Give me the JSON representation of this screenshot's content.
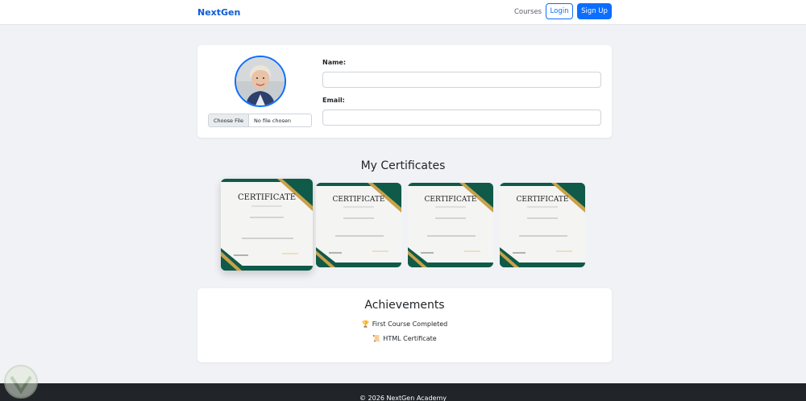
{
  "navbar": {
    "brand": "NextGen",
    "links": [
      {
        "label": "Courses"
      }
    ],
    "login_label": "Login",
    "signup_label": "Sign Up"
  },
  "profile": {
    "file_button_label": "Choose File",
    "file_status": "No file chosen",
    "name_label": "Name:",
    "name_value": "",
    "email_label": "Email:",
    "email_value": ""
  },
  "certificates": {
    "title": "My Certificates",
    "items": [
      {
        "heading": "CERTIFICATE"
      },
      {
        "heading": "CERTIFICATE"
      },
      {
        "heading": "CERTIFICATE"
      },
      {
        "heading": "CERTIFICATE"
      }
    ]
  },
  "achievements": {
    "title": "Achievements",
    "items": [
      {
        "icon": "trophy-icon",
        "glyph": "🏆",
        "label": "First Course Completed"
      },
      {
        "icon": "scroll-icon",
        "glyph": "📜",
        "label": "HTML Certificate"
      }
    ]
  },
  "footer": {
    "text": "© 2026 NextGen Academy"
  },
  "colors": {
    "primary": "#0d6efd",
    "brand": "#0d5bd6",
    "cert_green": "#0f5a48",
    "cert_gold": "#c9a14a",
    "footer_bg": "#212529"
  }
}
